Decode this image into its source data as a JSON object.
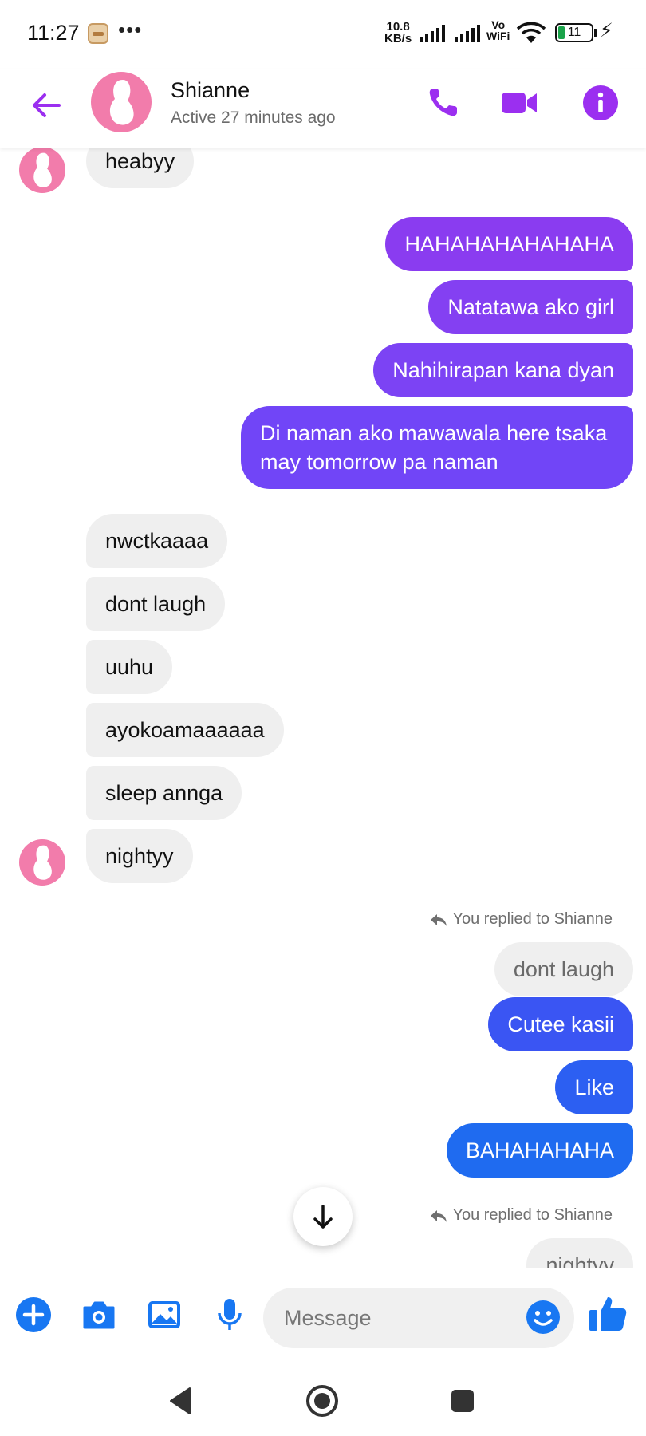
{
  "status_bar": {
    "time": "11:27",
    "dots": "•••",
    "speed_value": "10.8",
    "speed_unit": "KB/s",
    "vowifi_top": "Vo",
    "vowifi_bottom": "WiFi",
    "battery": "11"
  },
  "header": {
    "name": "Shianne",
    "status": "Active 27 minutes ago",
    "accent_color": "#9b2ff0"
  },
  "messages": {
    "m1": "heabyy",
    "m2": "HAHAHAHAHAHAHA",
    "m3": "Natatawa ako girl",
    "m4": "Nahihirapan kana dyan",
    "m5_line1": "Di naman ako mawawala here tsaka",
    "m5_line2": "may tomorrow pa naman",
    "m6": "nwctkaaaa",
    "m7": "dont laugh",
    "m8": "uuhu",
    "m9": "ayokoamaaaaaa",
    "m10": "sleep annga",
    "m11": "nightyy",
    "reply1_note": "You replied to Shianne",
    "reply1_quote": "dont laugh",
    "m12": "Cutee kasii",
    "m13": "Like",
    "m14": "BAHAHAHAHA",
    "reply2_note": "You replied to Shianne",
    "reply2_quote": "nightyy"
  },
  "composer": {
    "placeholder": "Message"
  },
  "icons": {
    "back": "arrow-left-icon",
    "call": "phone-icon",
    "video": "video-camera-icon",
    "info": "info-icon",
    "plus": "plus-icon",
    "camera": "camera-icon",
    "gallery": "image-icon",
    "mic": "microphone-icon",
    "emoji": "smiley-icon",
    "like": "thumbs-up-icon",
    "scroll": "arrow-down-icon"
  },
  "colors": {
    "outgoing_purple": "#8a3cf0",
    "outgoing_violet": "#7145f7",
    "outgoing_blue": "#3a55f3",
    "outgoing_blue2": "#1f6bf0",
    "composer_blue": "#1877f2"
  }
}
